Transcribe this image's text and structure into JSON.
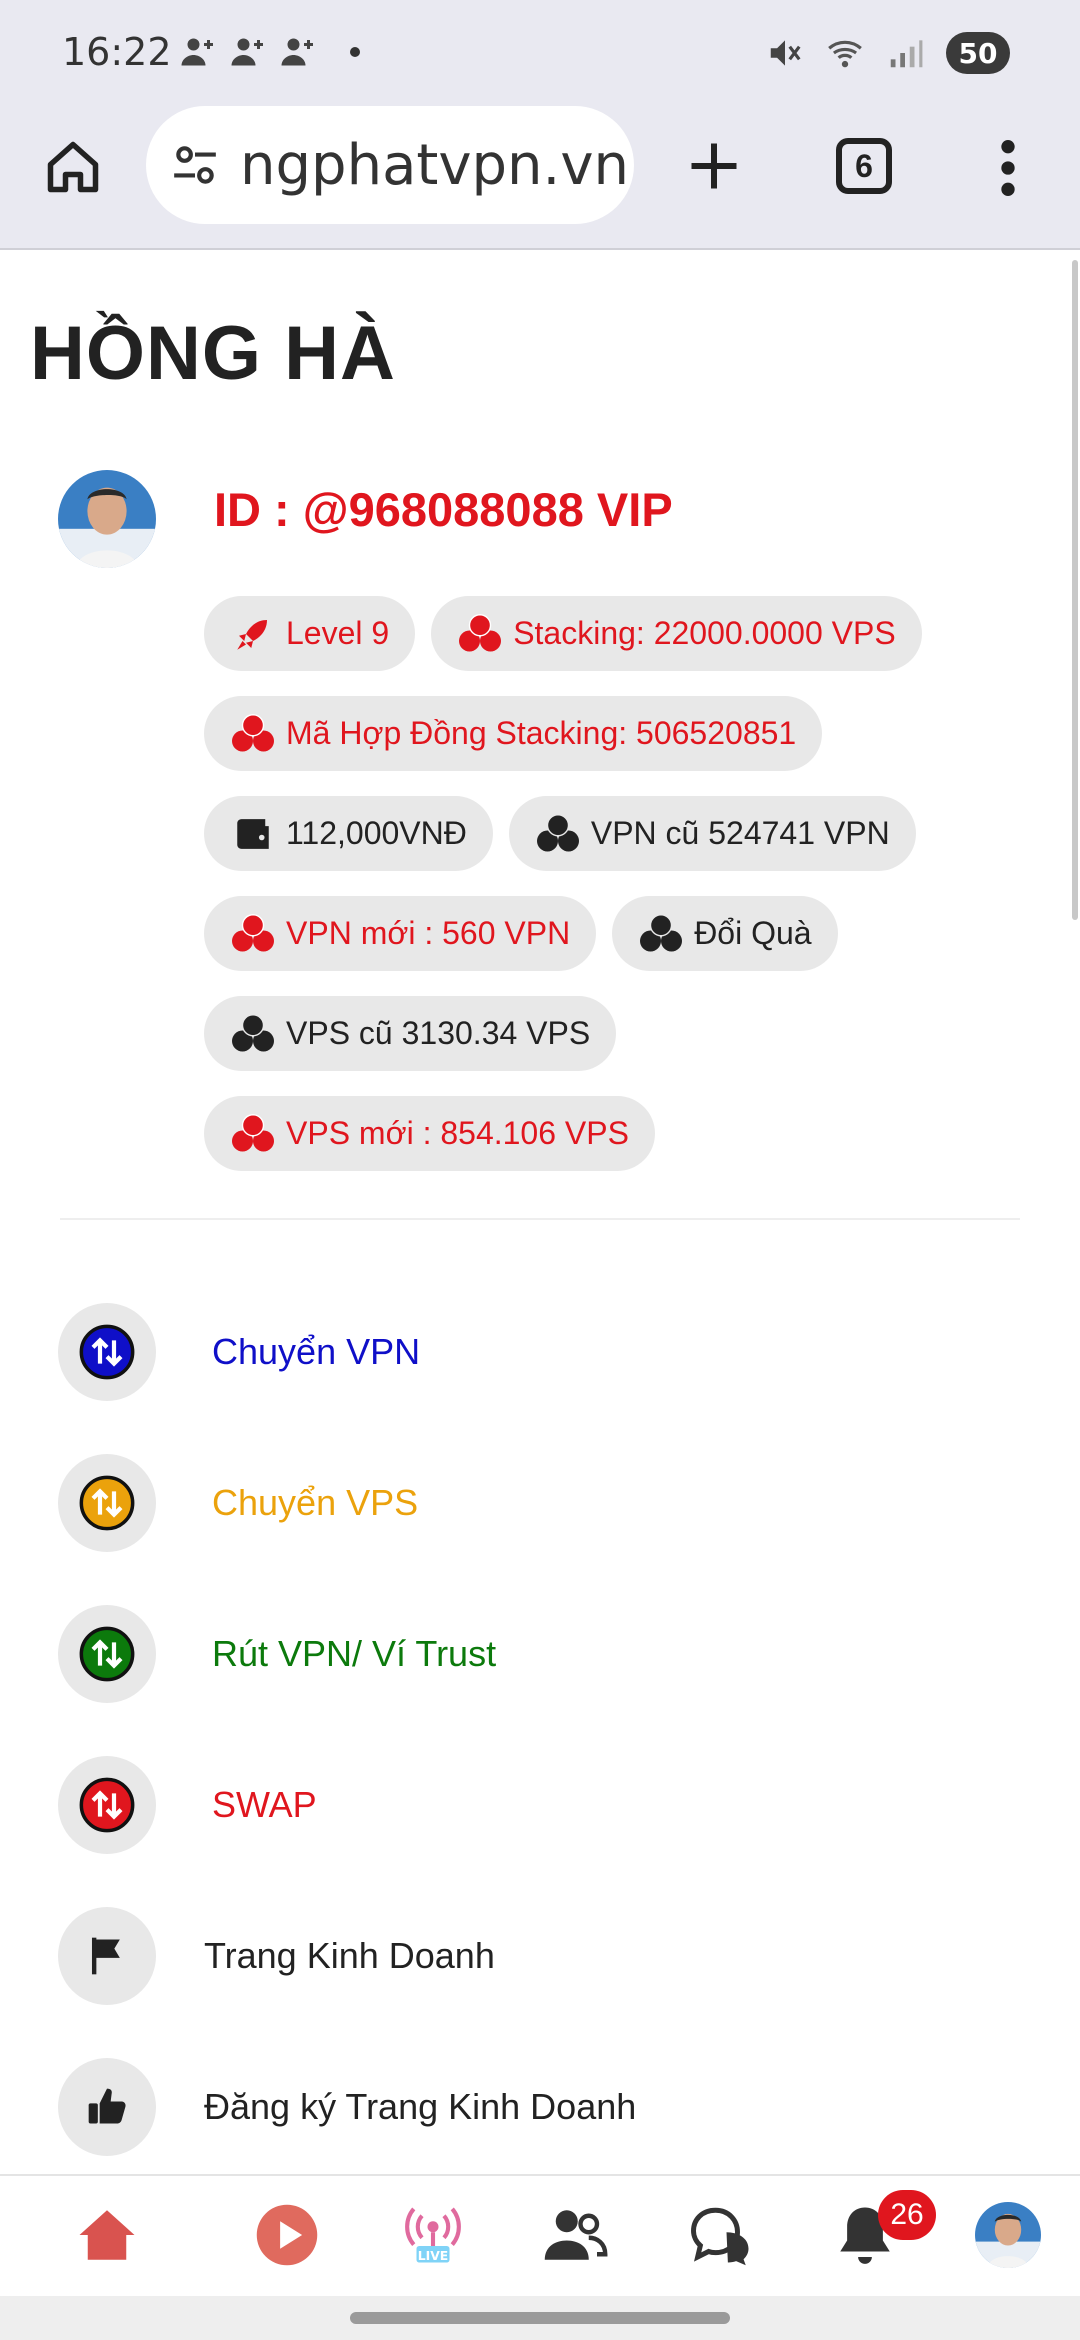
{
  "status_bar": {
    "time": "16:22",
    "battery": "50",
    "icons": [
      "person-add-icon",
      "person-add-icon",
      "person-add-icon",
      "mute-icon",
      "wifi-icon",
      "signal-icon"
    ]
  },
  "browser": {
    "url": "ngphatvpn.vn",
    "tab_count": "6",
    "icons": [
      "home-icon",
      "tune-icon",
      "plus-icon",
      "more-vert-icon"
    ]
  },
  "page": {
    "title": "HỒNG HÀ",
    "user_id": "ID : @968088088 VIP",
    "badges": [
      {
        "label": "Level 9",
        "color": "red",
        "icon": "rocket-icon"
      },
      {
        "label": "Stacking: 22000.0000 VPS",
        "color": "red",
        "icon": "coins-icon"
      },
      {
        "label": "Mã Hợp Đồng Stacking: 506520851",
        "color": "red",
        "icon": "coins-icon"
      },
      {
        "label": "112,000VNĐ",
        "color": "dark",
        "icon": "wallet-icon"
      },
      {
        "label": "VPN cũ 524741 VPN",
        "color": "dark",
        "icon": "coins-icon"
      },
      {
        "label": "VPN mới : 560 VPN",
        "color": "red",
        "icon": "coins-icon"
      },
      {
        "label": "Đổi Quà",
        "color": "dark",
        "icon": "coins-icon"
      },
      {
        "label": "VPS cũ 3130.34 VPS",
        "color": "dark",
        "icon": "coins-icon"
      },
      {
        "label": "VPS mới : 854.106 VPS",
        "color": "red",
        "icon": "coins-icon"
      }
    ],
    "menu": [
      {
        "label": "Chuyển VPN",
        "icon": "transfer-icon",
        "color": "#0f0fc8"
      },
      {
        "label": "Chuyển VPS",
        "icon": "transfer-icon",
        "color": "#eba20c"
      },
      {
        "label": "Rút VPN/ Ví Trust",
        "icon": "transfer-icon",
        "color": "#0c7a0c"
      },
      {
        "label": "SWAP",
        "icon": "transfer-icon",
        "color": "#e0161e"
      },
      {
        "label": "Trang Kinh Doanh",
        "icon": "flag-icon",
        "color": "#222222"
      },
      {
        "label": "Đăng ký Trang Kinh Doanh",
        "icon": "thumbs-up-icon",
        "color": "#222222"
      }
    ]
  },
  "bottom_nav": {
    "items": [
      "home-icon",
      "play-icon",
      "live-icon",
      "friends-icon",
      "chat-icon",
      "bell-icon",
      "profile-avatar"
    ],
    "live_label": "LIVE",
    "notification_count": "26"
  }
}
